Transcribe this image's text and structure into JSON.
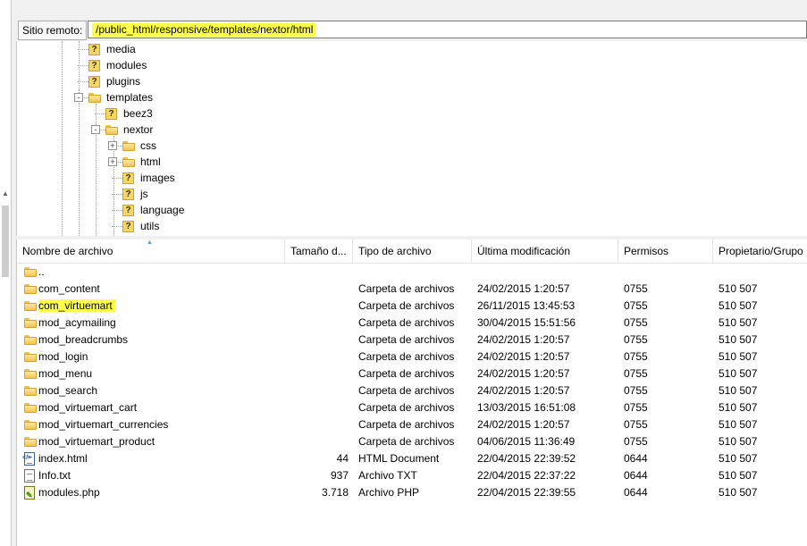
{
  "remote": {
    "label": "Sitio remoto:",
    "path": "/public_html/responsive/templates/nextor/html"
  },
  "tree": [
    {
      "name": "media",
      "icon": "question-folder-icon"
    },
    {
      "name": "modules",
      "icon": "question-folder-icon"
    },
    {
      "name": "plugins",
      "icon": "question-folder-icon"
    },
    {
      "name": "templates",
      "icon": "folder-icon",
      "expander": "-"
    },
    {
      "name": "beez3",
      "icon": "question-folder-icon"
    },
    {
      "name": "nextor",
      "icon": "folder-icon",
      "expander": "-"
    },
    {
      "name": "css",
      "icon": "folder-icon",
      "expander": "+"
    },
    {
      "name": "html",
      "icon": "folder-icon",
      "expander": "+"
    },
    {
      "name": "images",
      "icon": "question-folder-icon"
    },
    {
      "name": "js",
      "icon": "question-folder-icon"
    },
    {
      "name": "language",
      "icon": "question-folder-icon"
    },
    {
      "name": "utils",
      "icon": "question-folder-icon"
    }
  ],
  "columns": {
    "name": "Nombre de archivo",
    "size": "Tamaño d...",
    "type": "Tipo de archivo",
    "modified": "Última modificación",
    "perms": "Permisos",
    "owner": "Propietario/Grupo"
  },
  "files": [
    {
      "name": "..",
      "size": "",
      "type": "",
      "modified": "",
      "perms": "",
      "owner": "",
      "icon": "folder-icon"
    },
    {
      "name": "com_content",
      "size": "",
      "type": "Carpeta de archivos",
      "modified": "24/02/2015 1:20:57",
      "perms": "0755",
      "owner": "510 507",
      "icon": "folder-icon"
    },
    {
      "name": "com_virtuemart",
      "size": "",
      "type": "Carpeta de archivos",
      "modified": "26/11/2015 13:45:53",
      "perms": "0755",
      "owner": "510 507",
      "icon": "folder-icon",
      "highlight": true
    },
    {
      "name": "mod_acymailing",
      "size": "",
      "type": "Carpeta de archivos",
      "modified": "30/04/2015 15:51:56",
      "perms": "0755",
      "owner": "510 507",
      "icon": "folder-icon"
    },
    {
      "name": "mod_breadcrumbs",
      "size": "",
      "type": "Carpeta de archivos",
      "modified": "24/02/2015 1:20:57",
      "perms": "0755",
      "owner": "510 507",
      "icon": "folder-icon"
    },
    {
      "name": "mod_login",
      "size": "",
      "type": "Carpeta de archivos",
      "modified": "24/02/2015 1:20:57",
      "perms": "0755",
      "owner": "510 507",
      "icon": "folder-icon"
    },
    {
      "name": "mod_menu",
      "size": "",
      "type": "Carpeta de archivos",
      "modified": "24/02/2015 1:20:57",
      "perms": "0755",
      "owner": "510 507",
      "icon": "folder-icon"
    },
    {
      "name": "mod_search",
      "size": "",
      "type": "Carpeta de archivos",
      "modified": "24/02/2015 1:20:57",
      "perms": "0755",
      "owner": "510 507",
      "icon": "folder-icon"
    },
    {
      "name": "mod_virtuemart_cart",
      "size": "",
      "type": "Carpeta de archivos",
      "modified": "13/03/2015 16:51:08",
      "perms": "0755",
      "owner": "510 507",
      "icon": "folder-icon"
    },
    {
      "name": "mod_virtuemart_currencies",
      "size": "",
      "type": "Carpeta de archivos",
      "modified": "24/02/2015 1:20:57",
      "perms": "0755",
      "owner": "510 507",
      "icon": "folder-icon"
    },
    {
      "name": "mod_virtuemart_product",
      "size": "",
      "type": "Carpeta de archivos",
      "modified": "04/06/2015 11:36:49",
      "perms": "0755",
      "owner": "510 507",
      "icon": "folder-icon"
    },
    {
      "name": "index.html",
      "size": "44",
      "type": "HTML Document",
      "modified": "22/04/2015 22:39:52",
      "perms": "0644",
      "owner": "510 507",
      "icon": "html-file-icon"
    },
    {
      "name": "Info.txt",
      "size": "937",
      "type": "Archivo TXT",
      "modified": "22/04/2015 22:37:22",
      "perms": "0644",
      "owner": "510 507",
      "icon": "text-file-icon"
    },
    {
      "name": "modules.php",
      "size": "3.718",
      "type": "Archivo PHP",
      "modified": "22/04/2015 22:39:55",
      "perms": "0644",
      "owner": "510 507",
      "icon": "php-file-icon"
    }
  ],
  "colors": {
    "highlight": "#ffff4d",
    "folder": "#f2c54e"
  }
}
